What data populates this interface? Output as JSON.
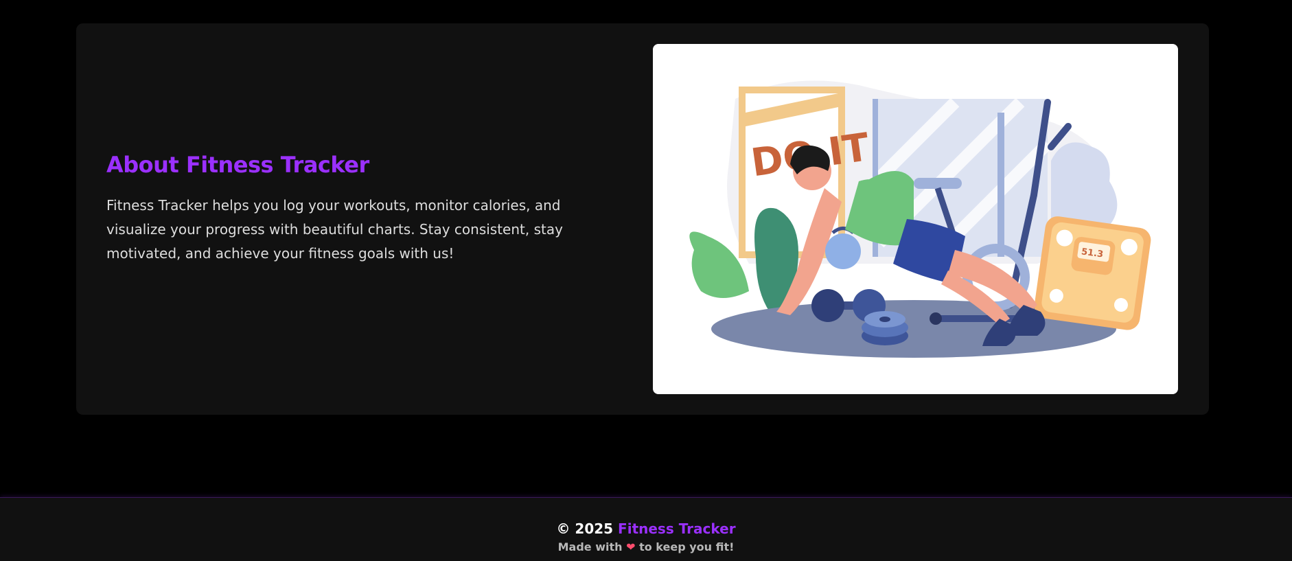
{
  "about": {
    "title": "About Fitness Tracker",
    "body": "Fitness Tracker helps you log your workouts, monitor calories, and visualize your progress with beautiful charts. Stay consistent, stay motivated, and achieve your fitness goals with us!",
    "illustration": {
      "poster_text": "DO IT",
      "scale_reading": "51.3"
    }
  },
  "footer": {
    "copyright": "© 2025",
    "brand": "Fitness Tracker",
    "made_with": "Made with",
    "heart": "❤",
    "tagline": "to keep you fit!"
  },
  "colors": {
    "background": "#000000",
    "card": "#111111",
    "accent": "#9b30ff",
    "text": "#dedede",
    "heart": "#ff4d6d"
  }
}
